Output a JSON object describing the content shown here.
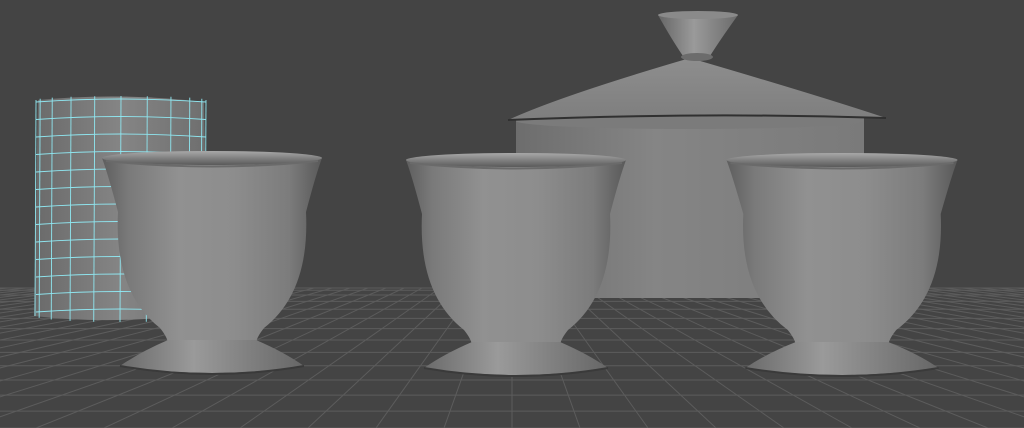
{
  "viewport": {
    "background": "#444444",
    "grid_color": "#5a5a5a",
    "grid_line_color": "#6e6e6e",
    "wireframe_color": "#8fe6f0",
    "shaded_gray": "#8a8a8a",
    "objects": [
      {
        "kind": "wireframe-cylinder",
        "selected": true
      },
      {
        "kind": "sugar-bowl-with-lid",
        "selected": false
      },
      {
        "kind": "cup",
        "selected": false
      },
      {
        "kind": "cup",
        "selected": false
      },
      {
        "kind": "cup",
        "selected": false
      }
    ]
  }
}
